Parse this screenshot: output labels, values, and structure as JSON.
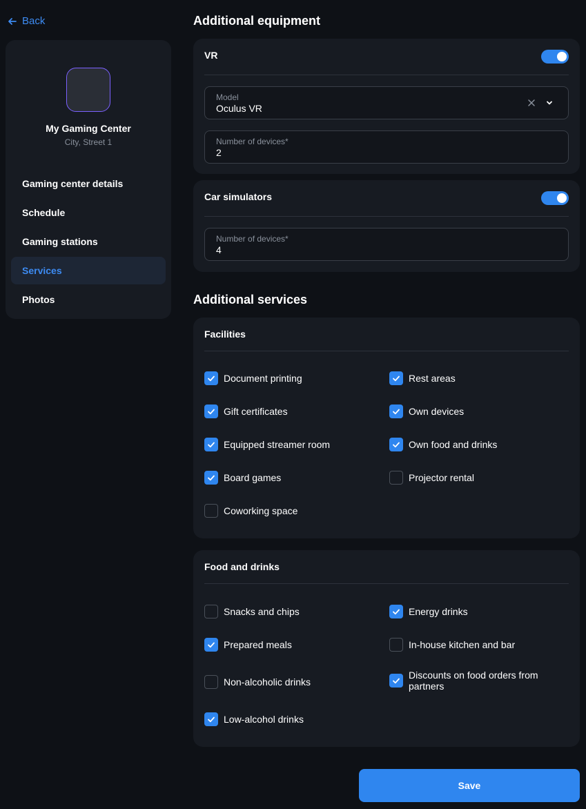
{
  "back_label": "Back",
  "sidebar": {
    "center_name": "My Gaming Center",
    "center_address": "City, Street 1",
    "items": [
      {
        "label": "Gaming center details"
      },
      {
        "label": "Schedule"
      },
      {
        "label": "Gaming stations"
      },
      {
        "label": "Services"
      },
      {
        "label": "Photos"
      }
    ],
    "active_index": 3
  },
  "equipment": {
    "title": "Additional equipment",
    "vr": {
      "title": "VR",
      "enabled": true,
      "model_label": "Model",
      "model_value": "Oculus VR",
      "devices_label": "Number of devices*",
      "devices_value": "2"
    },
    "car": {
      "title": "Car simulators",
      "enabled": true,
      "devices_label": "Number of devices*",
      "devices_value": "4"
    }
  },
  "services": {
    "title": "Additional services",
    "facilities": {
      "title": "Facilities",
      "items": [
        {
          "label": "Document printing",
          "checked": true
        },
        {
          "label": "Rest areas",
          "checked": true
        },
        {
          "label": "Gift certificates",
          "checked": true
        },
        {
          "label": "Own devices",
          "checked": true
        },
        {
          "label": "Equipped streamer room",
          "checked": true
        },
        {
          "label": "Own food and drinks",
          "checked": true
        },
        {
          "label": "Board games",
          "checked": true
        },
        {
          "label": "Projector rental",
          "checked": false
        },
        {
          "label": "Coworking space",
          "checked": false
        }
      ]
    },
    "food": {
      "title": "Food and drinks",
      "items": [
        {
          "label": "Snacks and chips",
          "checked": false
        },
        {
          "label": "Energy drinks",
          "checked": true
        },
        {
          "label": "Prepared meals",
          "checked": true
        },
        {
          "label": "In-house kitchen and bar",
          "checked": false
        },
        {
          "label": "Non-alcoholic drinks",
          "checked": false
        },
        {
          "label": "Discounts on food orders from partners",
          "checked": true
        },
        {
          "label": "Low-alcohol drinks",
          "checked": true
        }
      ]
    }
  },
  "save_label": "Save",
  "colors": {
    "accent": "#2f86ef",
    "background": "#0e1116",
    "card": "#171b22",
    "avatar_border": "#7b61ff"
  },
  "icons": {
    "back": "arrow-left-icon",
    "clear": "close-icon",
    "dropdown": "chevron-down-icon",
    "check": "checkmark-icon"
  }
}
